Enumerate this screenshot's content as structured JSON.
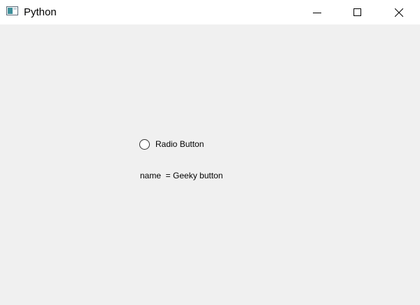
{
  "window": {
    "title": "Python",
    "app_icon": "python-window-icon",
    "controls": {
      "minimize_icon": "minimize-icon",
      "maximize_icon": "maximize-icon",
      "close_icon": "close-icon"
    }
  },
  "content": {
    "radio_button": {
      "label": "Radio Button",
      "checked": false
    },
    "name_label": "name  = Geeky button"
  },
  "colors": {
    "titlebar_bg": "#ffffff",
    "client_bg": "#f0f0f0",
    "text": "#000000"
  }
}
